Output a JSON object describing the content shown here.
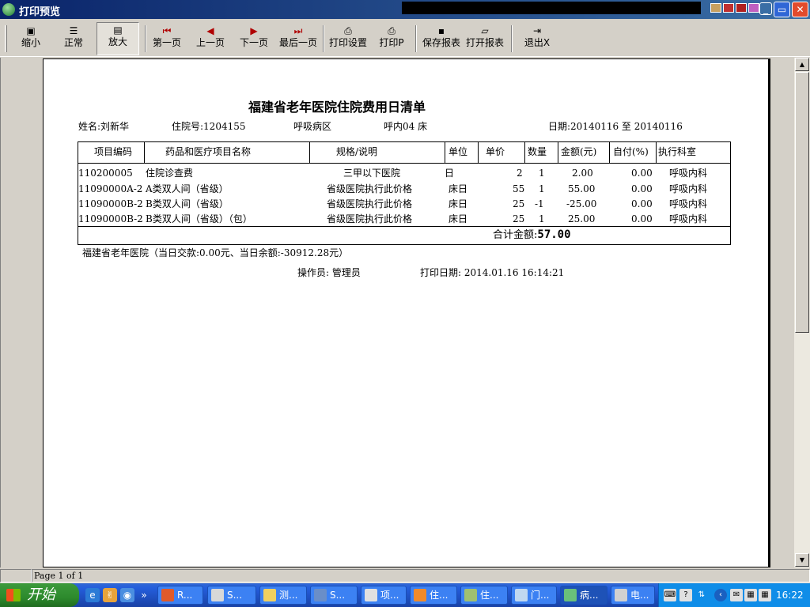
{
  "window": {
    "title": "打印预览"
  },
  "toolbar": {
    "zoom_out": "缩小",
    "normal": "正常",
    "zoom_in": "放大",
    "first_page": "第一页",
    "prev_page": "上一页",
    "next_page": "下一页",
    "last_page": "最后一页",
    "print_setup": "打印设置",
    "print": "打印P",
    "save_report": "保存报表",
    "open_report": "打开报表",
    "exit": "退出X"
  },
  "report": {
    "title": "福建省老年医院住院费用日清单",
    "patient_name": "姓名:刘新华",
    "admission_no": "住院号:1204155",
    "ward": "呼吸病区",
    "bed": "呼内04 床",
    "date_range": "日期:20140116 至 20140116",
    "columns": [
      "项目编码",
      "药品和医疗项目名称",
      "规格/说明",
      "单位",
      "单价",
      "数量",
      "金额(元)",
      "自付(%)",
      "执行科室"
    ],
    "rows": [
      {
        "code": "110200005",
        "name": "住院诊查费",
        "spec": "三甲以下医院",
        "unit": "日",
        "price": "2",
        "qty": "1",
        "amount": "2.00",
        "self_pay": "0.00",
        "dept": "呼吸内科"
      },
      {
        "code": "11090000A-2",
        "name": "A类双人间（省级）",
        "spec": "省级医院执行此价格",
        "unit": "床日",
        "price": "55",
        "qty": "1",
        "amount": "55.00",
        "self_pay": "0.00",
        "dept": "呼吸内科"
      },
      {
        "code": "11090000B-2",
        "name": "B类双人间（省级）",
        "spec": "省级医院执行此价格",
        "unit": "床日",
        "price": "25",
        "qty": "-1",
        "amount": "-25.00",
        "self_pay": "0.00",
        "dept": "呼吸内科"
      },
      {
        "code": "11090000B-2",
        "name": "B类双人间（省级）（包）",
        "spec": "省级医院执行此价格",
        "unit": "床日",
        "price": "25",
        "qty": "1",
        "amount": "25.00",
        "self_pay": "0.00",
        "dept": "呼吸内科"
      }
    ],
    "total_label": "合计金额:",
    "total_value": "57.00",
    "footer_note": "福建省老年医院（当日交款:0.00元、当日余额:-30912.28元）",
    "operator": "操作员: 管理员",
    "print_date": "打印日期: 2014.01.16 16:14:21"
  },
  "status": {
    "page_info": "Page 1 of 1"
  },
  "taskbar": {
    "start_label": "开始",
    "tasks": [
      "R...",
      "S...",
      "测...",
      "S...",
      "项...",
      "住...",
      "住...",
      "门...",
      "病...",
      "电..."
    ],
    "clock": "16:22"
  }
}
